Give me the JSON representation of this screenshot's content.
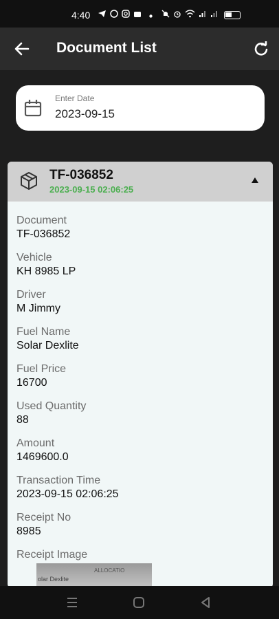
{
  "status_bar": {
    "time": "4:40"
  },
  "app_bar": {
    "title": "Document List",
    "back_icon": "arrow-left-icon",
    "refresh_icon": "refresh-icon"
  },
  "date_filter": {
    "label": "Enter Date",
    "value": "2023-09-15",
    "icon": "calendar-icon"
  },
  "document": {
    "title": "TF-036852",
    "datetime": "2023-09-15 02:06:25",
    "icon": "package-icon",
    "expanded": true,
    "fields": [
      {
        "label": "Document",
        "value": "TF-036852"
      },
      {
        "label": "Vehicle",
        "value": "KH 8985 LP"
      },
      {
        "label": "Driver",
        "value": "M Jimmy"
      },
      {
        "label": "Fuel Name",
        "value": "Solar Dexlite"
      },
      {
        "label": "Fuel Price",
        "value": "16700"
      },
      {
        "label": "Used Quantity",
        "value": "88"
      },
      {
        "label": "Amount",
        "value": "1469600.0"
      },
      {
        "label": "Transaction Time",
        "value": "2023-09-15 02:06:25"
      },
      {
        "label": "Receipt No",
        "value": "8985"
      }
    ],
    "receipt_image_label": "Receipt Image",
    "receipt_image_text": [
      "olar Dexlite",
      "ALLOCATIO"
    ]
  },
  "colors": {
    "app_bar": "#2c2c2c",
    "background": "#1e1e1e",
    "accent_green": "#4caf50",
    "card_header": "#d0d0d0"
  }
}
